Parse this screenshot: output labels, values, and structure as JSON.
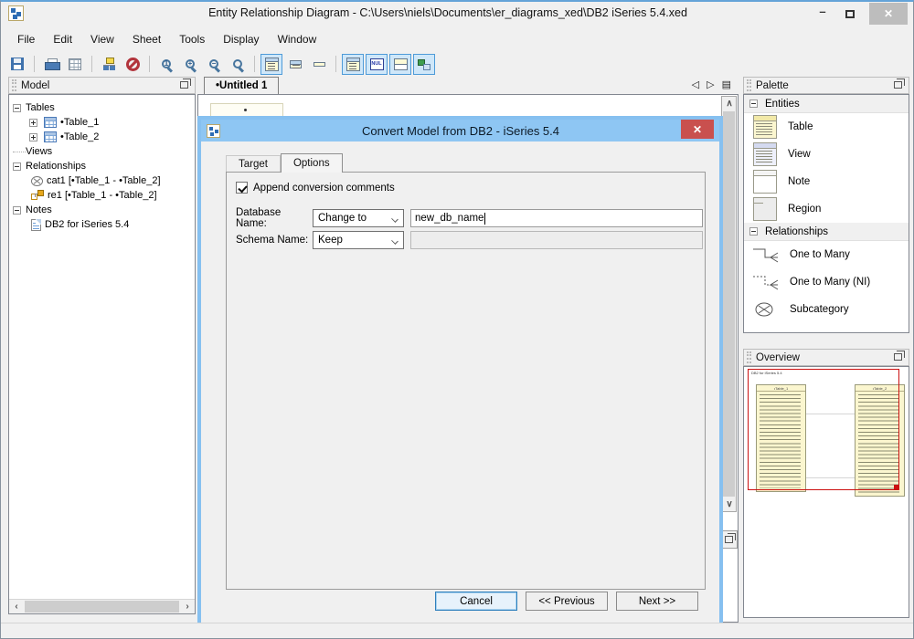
{
  "window": {
    "title": "Entity Relationship Diagram - C:\\Users\\niels\\Documents\\er_diagrams_xed\\DB2 iSeries 5.4.xed"
  },
  "icons": {
    "minimize": "–",
    "close": "✕",
    "dialog_close": "✕",
    "tab_prev": "◁",
    "tab_next": "▷",
    "sheet_list": "▤",
    "scroll_up": "∧",
    "scroll_down": "∨",
    "scroll_left": "‹",
    "scroll_right": "›",
    "zoom_actual": "1",
    "zoom_in": "+",
    "zoom_out": "−"
  },
  "menu": {
    "items": [
      "File",
      "Edit",
      "View",
      "Sheet",
      "Tools",
      "Display",
      "Window"
    ]
  },
  "toolbar": {
    "icon_names": [
      "save-icon",
      "print-icon",
      "grid-icon",
      "auto-layout-icon",
      "prohibit-icon",
      "zoom-actual-icon",
      "zoom-in-icon",
      "zoom-out-icon",
      "zoom-fit-icon",
      "table-detail-view-icon",
      "table-compact-view-icon",
      "table-minimal-view-icon",
      "show-attributes-icon",
      "show-null-icon",
      "show-header-icon",
      "foreign-key-view-icon"
    ],
    "nul_label": "NUL"
  },
  "model_panel": {
    "title": "Model",
    "tree": {
      "tables_label": "Tables",
      "table1": "•Table_1",
      "table2": "•Table_2",
      "views_label": "Views",
      "relationships_label": "Relationships",
      "cat1": "cat1 [•Table_1 - •Table_2]",
      "re1": "re1 [•Table_1 - •Table_2]",
      "notes_label": "Notes",
      "note1": "DB2 for iSeries 5.4"
    }
  },
  "tab_bar": {
    "active_tab": "•Untitled 1"
  },
  "dialog": {
    "title": "Convert Model from DB2 - iSeries 5.4",
    "tabs": [
      "Target",
      "Options"
    ],
    "active_tab": "Options",
    "checkbox_label": "Append conversion comments",
    "checkbox_checked": true,
    "database_name_label": "Database Name:",
    "database_name_mode": "Change to",
    "database_name_value": "new_db_name",
    "schema_name_label": "Schema Name:",
    "schema_name_mode": "Keep",
    "schema_name_value": "",
    "buttons": {
      "cancel": "Cancel",
      "previous": "<< Previous",
      "next": "Next >>"
    },
    "colors": {
      "titlebar": "#8ec6f3",
      "border": "#86c0f0",
      "close_button": "#c9504e"
    }
  },
  "palette": {
    "title": "Palette",
    "sections": [
      {
        "label": "Entities",
        "items": [
          "Table",
          "View",
          "Note",
          "Region"
        ]
      },
      {
        "label": "Relationships",
        "items": [
          "One to Many",
          "One to Many (NI)",
          "Subcategory"
        ]
      }
    ]
  },
  "overview": {
    "title": "Overview",
    "note_label": "DB2 for iSeries 5.4",
    "table1_label": "•Table_1",
    "table2_label": "•Table_2",
    "viewport_color": "#cc1111",
    "table_fill": "#fbf6cf"
  }
}
